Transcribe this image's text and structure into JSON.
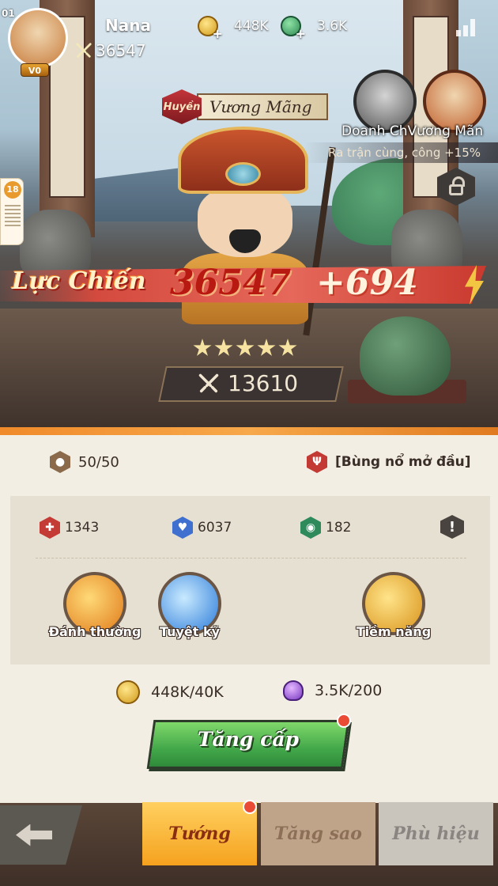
{
  "player": {
    "level": "01",
    "vip": "V0",
    "name": "Nana",
    "power": "36547"
  },
  "currency": {
    "gold": "448K",
    "jade": "3.6K"
  },
  "side_badge": {
    "age": "18"
  },
  "hero": {
    "rarity": "Huyền",
    "name": "Vương Mãng",
    "stars": 5,
    "power": "13610"
  },
  "bond": {
    "names": "Doanh ChVương Mãn",
    "effect": "Ra trận cùng, công +15%"
  },
  "combat_power": {
    "label": "Lực Chiến",
    "value": "36547",
    "gain": "+694"
  },
  "panel": {
    "level": "50/50",
    "trait": "[Bùng nổ mở đầu]",
    "stats": {
      "attack": "1343",
      "hp": "6037",
      "defense": "182"
    },
    "skills": [
      {
        "label": "Đánh thường"
      },
      {
        "label": "Tuyệt kỹ"
      },
      {
        "label": "Tiềm năng"
      }
    ],
    "costs": {
      "gold": "448K/40K",
      "gem": "3.5K/200"
    },
    "upgrade_label": "Tăng cấp"
  },
  "tabs": [
    {
      "label": "Tướng",
      "active": true
    },
    {
      "label": "Tăng sao",
      "active": false
    },
    {
      "label": "Phù hiệu",
      "active": false
    }
  ],
  "colors": {
    "accent_orange": "#f5a21e",
    "upgrade_green": "#43a84a",
    "power_red": "#b81a12",
    "notification_red": "#ea4b35"
  }
}
